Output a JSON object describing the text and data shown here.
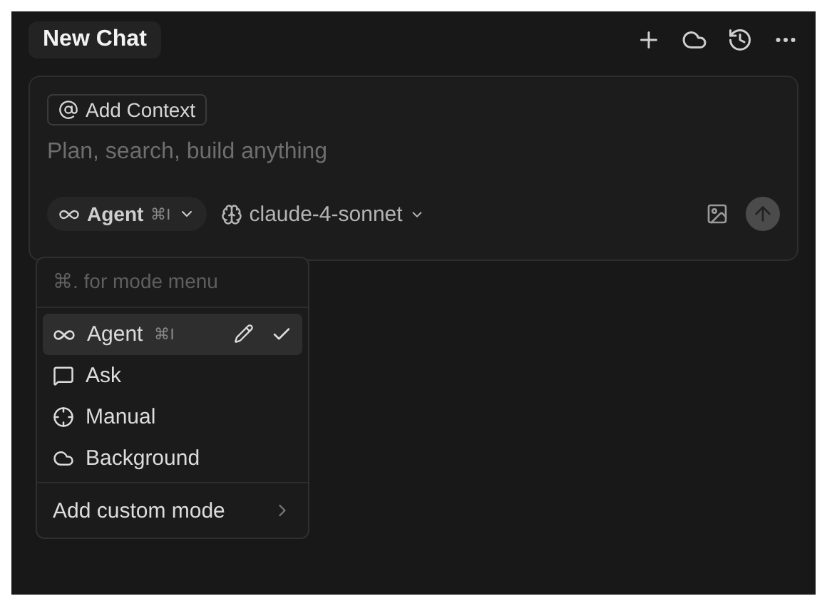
{
  "header": {
    "title": "New Chat"
  },
  "composer": {
    "context_button": "Add Context",
    "placeholder": "Plan, search, build anything",
    "mode": {
      "label": "Agent",
      "shortcut": "⌘I"
    },
    "model": "claude-4-sonnet"
  },
  "mode_menu": {
    "hint": "⌘. for mode menu",
    "items": [
      {
        "label": "Agent",
        "shortcut": "⌘I",
        "kind": "agent",
        "selected": true
      },
      {
        "label": "Ask",
        "kind": "ask",
        "selected": false
      },
      {
        "label": "Manual",
        "kind": "manual",
        "selected": false
      },
      {
        "label": "Background",
        "kind": "background",
        "selected": false
      }
    ],
    "footer": "Add custom mode"
  }
}
